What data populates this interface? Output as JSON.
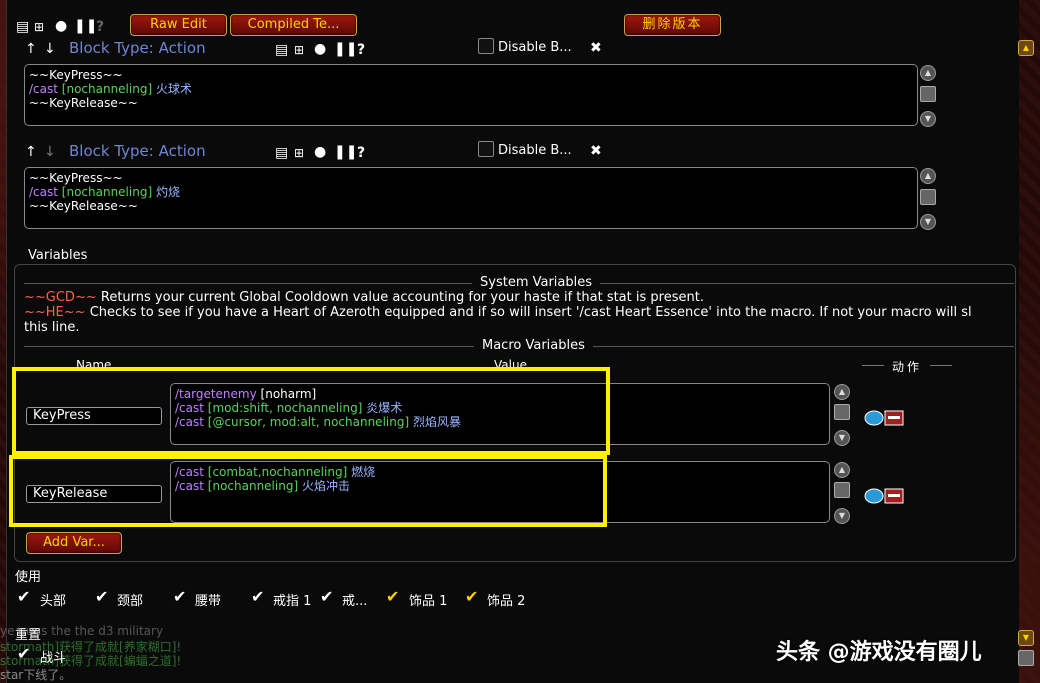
{
  "toolbar": {
    "raw_edit": "Raw Edit",
    "compiled": "Compiled Te...",
    "delete_version": "删除版本"
  },
  "blocks": [
    {
      "type_label": "Block Type: Action",
      "disable_label": "Disable B...",
      "lines": [
        {
          "a": "~~KeyPress~~"
        },
        {
          "cmd": "/cast",
          "cond": "[nochanneling]",
          "spell": "火球术"
        },
        {
          "a": "~~KeyRelease~~"
        }
      ]
    },
    {
      "type_label": "Block Type: Action",
      "disable_label": "Disable B...",
      "lines": [
        {
          "a": "~~KeyPress~~"
        },
        {
          "cmd": "/cast",
          "cond": "[nochanneling]",
          "spell": "灼烧"
        },
        {
          "a": "~~KeyRelease~~"
        }
      ]
    }
  ],
  "variables": {
    "title": "Variables",
    "system_title": "System Variables",
    "gcd_token": "~~GCD~~",
    "gcd_desc": "Returns your current Global Cooldown value accounting for your haste if that stat is present.",
    "he_token": "~~HE~~",
    "he_desc": "Checks to see if you have a Heart of Azeroth equipped and if so will insert '/cast Heart Essence' into the macro.  If not your macro will sl",
    "he_desc2": "this line.",
    "macro_title": "Macro Variables",
    "col_name": "Name",
    "col_value": "Value",
    "col_action": "动作",
    "rows": [
      {
        "name": "KeyPress",
        "lines": [
          {
            "cmd": "/targetenemy",
            "cond": "[noharm]",
            "spell": ""
          },
          {
            "cmd": "/cast",
            "cond": "[mod:shift, nochanneling]",
            "spell": "炎爆术"
          },
          {
            "cmd": "/cast",
            "cond": "[@cursor, mod:alt, nochanneling]",
            "spell": "烈焰风暴"
          }
        ]
      },
      {
        "name": "KeyRelease",
        "lines": [
          {
            "cmd": "/cast",
            "cond": "[combat,nochanneling]",
            "spell": "燃烧"
          },
          {
            "cmd": "/cast",
            "cond": "[nochanneling]",
            "spell": "火焰冲击"
          }
        ]
      }
    ],
    "add_var": "Add Var..."
  },
  "use_section": {
    "title": "使用",
    "items": [
      {
        "label": "头部",
        "checked": true
      },
      {
        "label": "颈部",
        "checked": true
      },
      {
        "label": "腰带",
        "checked": true
      },
      {
        "label": "戒指 1",
        "checked": true
      },
      {
        "label": "戒...",
        "checked": true
      },
      {
        "label": "饰品 1",
        "checked": true
      },
      {
        "label": "饰品 2",
        "checked": true
      }
    ]
  },
  "reset_section": {
    "title": "重置",
    "items": [
      {
        "label": "战斗",
        "checked": true
      }
    ]
  },
  "chat": {
    "line1": "ye guns the the d3 military",
    "line2": "stormath]获得了成就[养家糊口]!",
    "line3": "stormath]获得了成就[蝙蝠之道]!",
    "line4": "star下线了。"
  },
  "watermark": "头条 @游戏没有圈儿",
  "icons": {
    "tool_icons": [
      "page-icon",
      "tree-icon",
      "circle-icon",
      "pause-icon",
      "help-icon"
    ],
    "close": "close-icon",
    "up_arrow": "arrow-up-icon",
    "down_arrow": "arrow-down-icon"
  },
  "colors": {
    "highlight": "#fff200",
    "gold": "#ffd100",
    "block_type": "#6e86d6",
    "cmd": "#c080ff",
    "cond": "#5bd25b"
  }
}
